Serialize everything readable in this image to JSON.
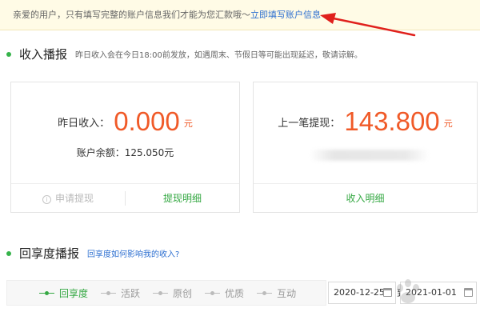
{
  "notice": {
    "text": "亲爱的用户，只有填写完整的账户信息我们才能为您汇款哦～",
    "link": "立即填写账户信息"
  },
  "income_section": {
    "title": "收入播报",
    "subtitle": "昨日收入会在今日18:00前发放，如遇周末、节假日等可能出现延迟，敬请谅解。"
  },
  "card_left": {
    "label": "昨日收入：",
    "amount": "0.000",
    "unit": "元",
    "balance": "账户余额：125.050元",
    "btn_withdraw": "申请提现",
    "btn_detail": "提现明细"
  },
  "card_right": {
    "label": "上一笔提现：",
    "amount": "143.800",
    "unit": "元",
    "btn_income": "收入明细"
  },
  "share_section": {
    "title": "回享度播报",
    "link": "回享度如何影响我的收入?"
  },
  "filters": [
    {
      "label": "回享度",
      "active": true
    },
    {
      "label": "活跃",
      "active": false
    },
    {
      "label": "原创",
      "active": false
    },
    {
      "label": "优质",
      "active": false
    },
    {
      "label": "互动",
      "active": false
    }
  ],
  "date_range": {
    "from": "2020-12-25",
    "separator": "到",
    "to": "2021-01-01"
  },
  "colors": {
    "accent_green": "#35a843",
    "amount_orange": "#f05a28",
    "link_blue": "#2d6fd0",
    "arrow_red": "#e0201c"
  }
}
